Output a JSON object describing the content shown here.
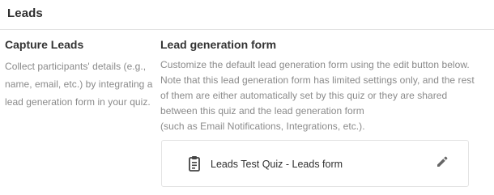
{
  "section": {
    "title": "Leads"
  },
  "capture": {
    "title": "Capture Leads",
    "description": "Collect participants' details (e.g.,\nname, email, etc.) by integrating a\nlead generation form in your quiz."
  },
  "lead_form": {
    "title": "Lead generation form",
    "description": "Customize the default lead generation form using the edit button below.\nNote that this lead generation form has limited settings only, and the rest\nof them are either automatically set by this quiz or they are shared\nbetween this quiz and the lead generation form\n(such as Email Notifications, Integrations, etc.).",
    "form_name": "Leads Test Quiz - Leads form",
    "form_icon": "clipboard-icon",
    "edit_icon": "pencil-icon"
  },
  "colors": {
    "text_primary": "#333333",
    "text_secondary": "#8a8a8a",
    "border": "#e2e2e2",
    "icon": "#555555"
  }
}
